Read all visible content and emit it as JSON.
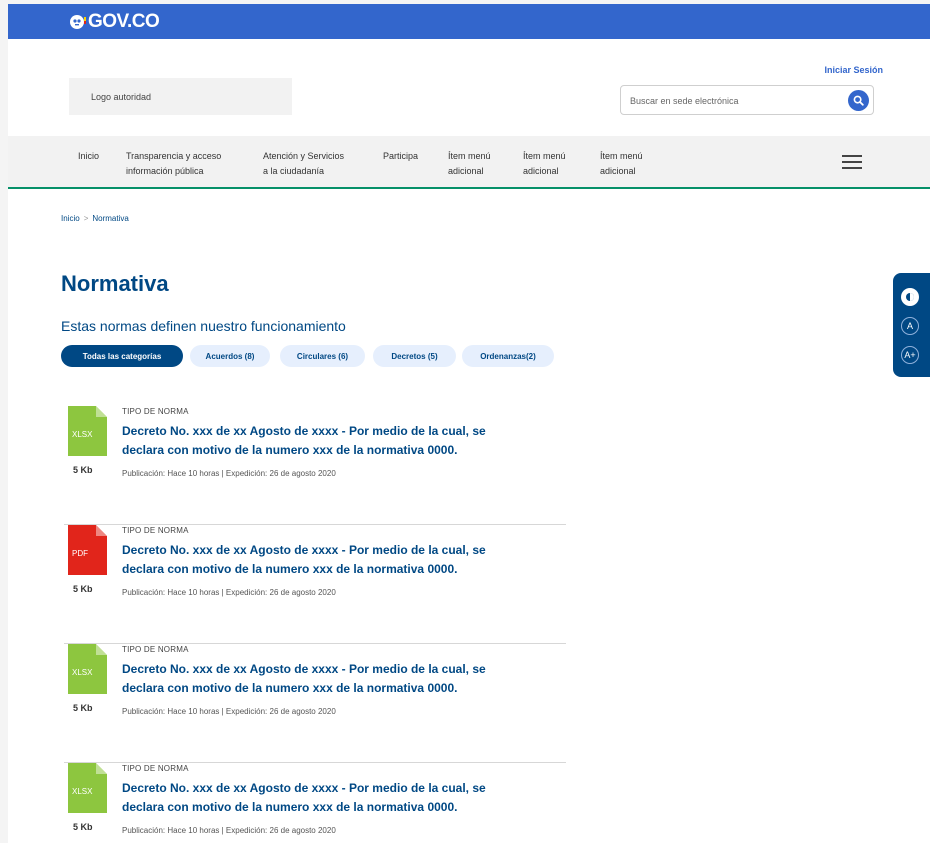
{
  "gov_bar": {
    "logo_text": "GOV.CO"
  },
  "header": {
    "login_label": "Iniciar Sesión",
    "logo_placeholder": "Logo autoridad",
    "search": {
      "placeholder": "Buscar en sede electrónica",
      "value": ""
    }
  },
  "nav": {
    "items": [
      {
        "line1": "Inicio",
        "line2": ""
      },
      {
        "line1": "Transparencia y acceso",
        "line2": "información pública"
      },
      {
        "line1": "Atención y Servicios",
        "line2": "a la ciudadanía"
      },
      {
        "line1": "Participa",
        "line2": ""
      },
      {
        "line1": "Ítem menú",
        "line2": "adicional"
      },
      {
        "line1": "Ítem menú",
        "line2": "adicional"
      },
      {
        "line1": "Ítem menú",
        "line2": "adicional"
      }
    ]
  },
  "breadcrumb": {
    "home": "Inicio",
    "separator": ">",
    "current": "Normativa"
  },
  "page": {
    "title": "Normativa",
    "subtitle": "Estas normas definen nuestro funcionamiento"
  },
  "filters": [
    {
      "label": "Todas las categorías",
      "active": true
    },
    {
      "label": "Acuerdos (8)",
      "active": false
    },
    {
      "label": "Circulares (6)",
      "active": false
    },
    {
      "label": "Decretos (5)",
      "active": false
    },
    {
      "label": "Ordenanzas(2)",
      "active": false
    }
  ],
  "documents": [
    {
      "file_type": "XLSX",
      "file_color": "#8dc63f",
      "size": "5 Kb",
      "type_label": "TIPO DE NORMA",
      "title_line1": "Decreto No. xxx de xx Agosto de xxxx - Por medio de la cual, se",
      "title_line2": "declara con motivo de la numero xxx de la normativa 0000.",
      "meta": "Publicación: Hace 10 horas | Expedición: 26 de agosto 2020"
    },
    {
      "file_type": "PDF",
      "file_color": "#e1251b",
      "size": "5 Kb",
      "type_label": "TIPO DE NORMA",
      "title_line1": "Decreto No. xxx de xx Agosto de xxxx - Por medio de la cual, se",
      "title_line2": "declara con motivo de la numero xxx de la normativa 0000.",
      "meta": "Publicación: Hace 10 horas | Expedición: 26 de agosto 2020"
    },
    {
      "file_type": "XLSX",
      "file_color": "#8dc63f",
      "size": "5 Kb",
      "type_label": "TIPO DE NORMA",
      "title_line1": "Decreto No. xxx de xx Agosto de xxxx - Por medio de la cual, se",
      "title_line2": "declara con motivo de la numero xxx de la normativa 0000.",
      "meta": "Publicación: Hace 10 horas | Expedición: 26 de agosto 2020"
    },
    {
      "file_type": "XLSX",
      "file_color": "#8dc63f",
      "size": "5 Kb",
      "type_label": "TIPO DE NORMA",
      "title_line1": "Decreto No. xxx de xx Agosto de xxxx - Por medio de la cual, se",
      "title_line2": "declara con motivo de la numero xxx de la normativa 0000.",
      "meta": "Publicación: Hace 10 horas | Expedición: 26 de agosto 2020"
    }
  ],
  "accessibility_tools": [
    {
      "icon": "contrast-icon",
      "label": ""
    },
    {
      "icon": "decrease-text-icon",
      "label": "A"
    },
    {
      "icon": "increase-text-icon",
      "label": "A+"
    }
  ],
  "colors": {
    "gov_blue": "#3366cc",
    "title_blue": "#004884",
    "nav_green_border": "#069169",
    "chip_bg": "#e6effd"
  }
}
